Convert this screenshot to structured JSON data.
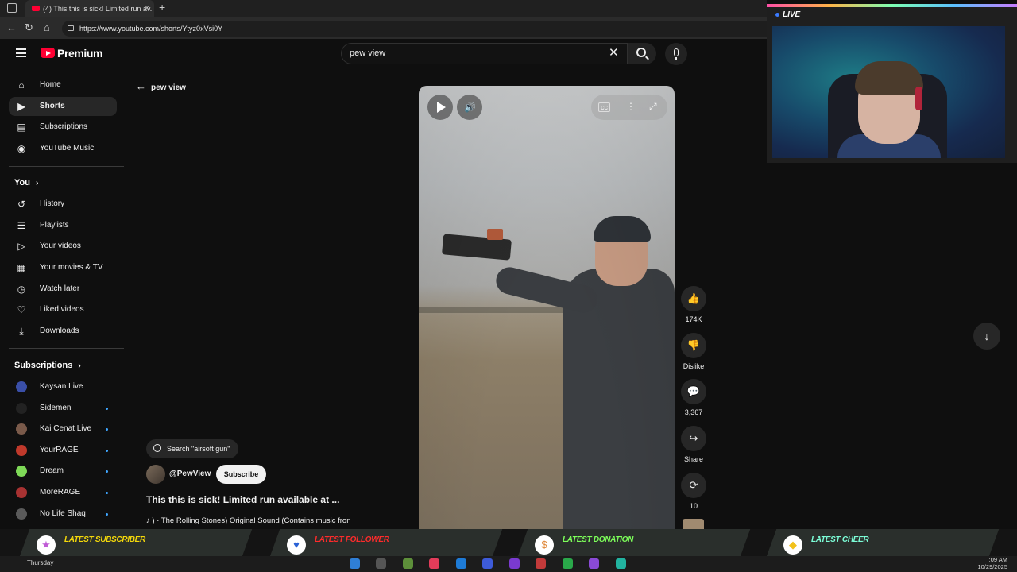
{
  "browser": {
    "tab_title": "(4) This this is sick! Limited run av...",
    "tab_close": "×",
    "new_tab": "+",
    "url": "https://www.youtube.com/shorts/Ytyz0xVsi0Y"
  },
  "header": {
    "logo_text": "Premium",
    "search_value": "pew view",
    "clear_glyph": "✕"
  },
  "sidebar": {
    "main_items": [
      {
        "label": "Home",
        "icon": "home-icon"
      },
      {
        "label": "Shorts",
        "icon": "shorts-icon"
      },
      {
        "label": "Subscriptions",
        "icon": "subscriptions-icon"
      },
      {
        "label": "YouTube Music",
        "icon": "youtube-music-icon"
      }
    ],
    "you_title": "You",
    "you_items": [
      {
        "label": "History",
        "icon": "history-icon"
      },
      {
        "label": "Playlists",
        "icon": "playlists-icon"
      },
      {
        "label": "Your videos",
        "icon": "your-videos-icon"
      },
      {
        "label": "Your movies & TV",
        "icon": "movies-icon"
      },
      {
        "label": "Watch later",
        "icon": "watch-later-icon"
      },
      {
        "label": "Liked videos",
        "icon": "liked-icon"
      },
      {
        "label": "Downloads",
        "icon": "download-icon"
      }
    ],
    "subs_title": "Subscriptions",
    "subs": [
      {
        "name": "Kaysan Live",
        "color": "#3a4fa8",
        "dot": false
      },
      {
        "name": "Sidemen",
        "color": "#222222",
        "dot": true
      },
      {
        "name": "Kai Cenat Live",
        "color": "#7a5a4a",
        "dot": true
      },
      {
        "name": "YourRAGE",
        "color": "#c0392b",
        "dot": true
      },
      {
        "name": "Dream",
        "color": "#7ed957",
        "dot": true
      },
      {
        "name": "MoreRAGE",
        "color": "#a83232",
        "dot": true
      },
      {
        "name": "No Life Shaq",
        "color": "#5a5a5a",
        "dot": true
      }
    ]
  },
  "shorts": {
    "back_label": "pew view",
    "search_chip": "Search \"airsoft gun\"",
    "channel": "@PewView",
    "subscribe": "Subscribe",
    "title": "This this is sick! Limited run available at ...",
    "sound": "♪ ) · The Rolling Stones)    Original Sound (Contains music fron",
    "actions": [
      {
        "label": "174K",
        "icon": "like-icon",
        "glyph": "👍"
      },
      {
        "label": "Dislike",
        "icon": "dislike-icon",
        "glyph": "👎"
      },
      {
        "label": "3,367",
        "icon": "comments-icon",
        "glyph": "💬"
      },
      {
        "label": "Share",
        "icon": "share-icon",
        "glyph": "↪"
      },
      {
        "label": "10",
        "icon": "remix-icon",
        "glyph": "⟳"
      }
    ],
    "down_glyph": "↓"
  },
  "stream": {
    "live_label": "LIVE",
    "alerts": [
      {
        "label": "LATEST SUBSCRIBER",
        "color": "#f5d90a",
        "icon": "star-icon",
        "glyph": "★",
        "icon_color": "#c05cd6"
      },
      {
        "label": "LATEST FOLLOWER",
        "color": "#ff2b2b",
        "icon": "heart-icon",
        "glyph": "♥",
        "icon_color": "#2a62d6"
      },
      {
        "label": "LATEST DONATION",
        "color": "#7dff5a",
        "icon": "dollar-icon",
        "glyph": "$",
        "icon_color": "#e08a3c"
      },
      {
        "label": "LATEST CHEER",
        "color": "#7dffd9",
        "icon": "diamond-icon",
        "glyph": "◆",
        "icon_color": "#f2c21b"
      }
    ]
  },
  "taskbar": {
    "day": "Thursday",
    "time": ":09 AM",
    "date": "10/29/2025"
  }
}
